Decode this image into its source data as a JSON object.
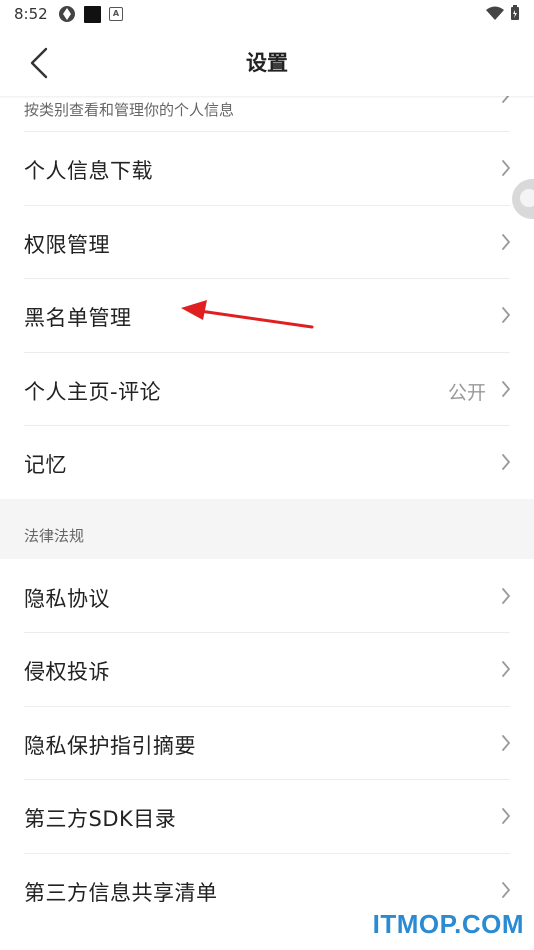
{
  "status_bar": {
    "time": "8:52",
    "a_glyph": "A"
  },
  "nav": {
    "title": "设置"
  },
  "partial_row": {
    "subtitle": "按类别查看和管理你的个人信息"
  },
  "section1": {
    "items": [
      {
        "label": "个人信息下载",
        "value": ""
      },
      {
        "label": "权限管理",
        "value": ""
      },
      {
        "label": "黑名单管理",
        "value": ""
      },
      {
        "label": "个人主页-评论",
        "value": "公开"
      },
      {
        "label": "记忆",
        "value": ""
      }
    ]
  },
  "section2": {
    "header": "法律法规",
    "items": [
      {
        "label": "隐私协议"
      },
      {
        "label": "侵权投诉"
      },
      {
        "label": "隐私保护指引摘要"
      },
      {
        "label": "第三方SDK目录"
      },
      {
        "label": "第三方信息共享清单"
      }
    ]
  },
  "watermark": "ITMOP.COM",
  "colors": {
    "accent_arrow": "#e02020",
    "watermark": "#2a8bd2",
    "section_bg": "#f5f5f5"
  }
}
